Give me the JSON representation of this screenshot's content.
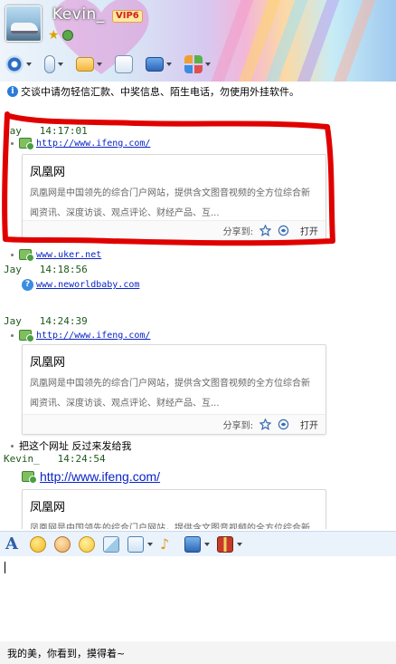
{
  "header": {
    "nickname": "Kevin_",
    "vip_badge": "VIP6",
    "toolbar": [
      {
        "icon": "camera-icon"
      },
      {
        "icon": "microphone-icon"
      },
      {
        "icon": "folder-transfer-icon"
      },
      {
        "icon": "add-contact-icon"
      },
      {
        "icon": "remote-desktop-icon"
      },
      {
        "icon": "apps-grid-icon"
      }
    ]
  },
  "warning": {
    "text": "交谈中请勿轻信汇款、中奖信息、陌生电话，勿使用外挂软件。"
  },
  "chat": {
    "messages": [
      {
        "sender": "Jay",
        "time": "14:17:01",
        "link": "http://www.ifeng.com/"
      },
      {
        "link": "www.uker.net"
      },
      {
        "sender": "Jay",
        "time": "14:18:56",
        "link": "www.neworldbaby.com"
      },
      {
        "sender": "Jay",
        "time": "14:24:39",
        "link": "http://www.ifeng.com/"
      },
      {
        "text": "把这个网址 反过来发给我"
      },
      {
        "sender": "Kevin_",
        "time": "14:24:54",
        "link": "http://www.ifeng.com/"
      }
    ],
    "card": {
      "title": "凤凰网",
      "description": "凤凰网是中国领先的综合门户网站，提供含文图音视频的全方位综合新闻资讯、深度访谈、观点评论、财经产品、互...",
      "share_label": "分享到:",
      "open_label": "打开"
    }
  },
  "input_toolbar": [
    {
      "icon": "font-icon"
    },
    {
      "icon": "emoji-icon"
    },
    {
      "icon": "magic-emoji-icon"
    },
    {
      "icon": "shake-icon"
    },
    {
      "icon": "image-icon"
    },
    {
      "icon": "screenshot-icon"
    },
    {
      "icon": "music-icon"
    },
    {
      "icon": "screen-share-icon"
    },
    {
      "icon": "gift-icon"
    }
  ],
  "signature": "我的美，你看到，摸得着~",
  "colors": {
    "link": "#0a24c8",
    "sender": "#1f5a1f",
    "annotation_red": "#e00000",
    "toolbar_bg": "#eaf2fb"
  }
}
